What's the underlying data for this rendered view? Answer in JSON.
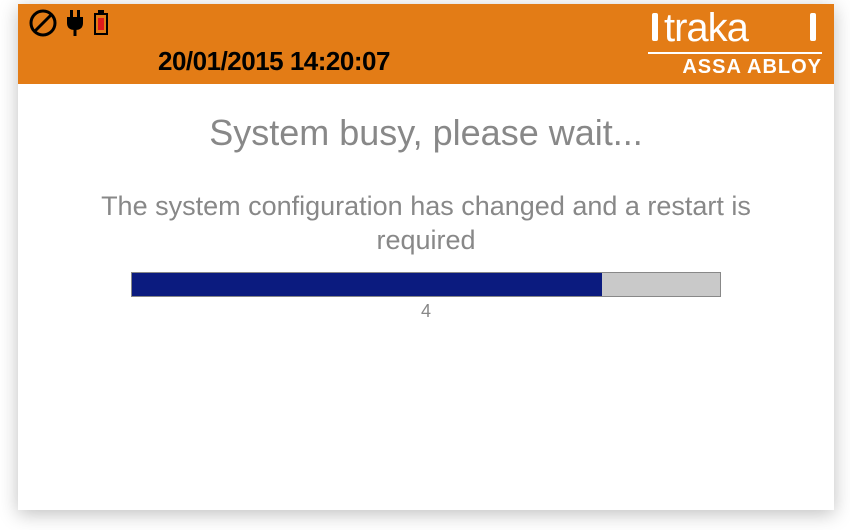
{
  "header": {
    "datetime": "20/01/2015 14:20:07",
    "brand_name": "traka",
    "brand_parent": "ASSA ABLOY"
  },
  "icons": {
    "prohibit": "prohibit-icon",
    "plug": "plug-icon",
    "usb": "usb-icon"
  },
  "content": {
    "title": "System busy, please wait...",
    "message": "The system configuration has changed and a restart is required"
  },
  "progress": {
    "percent": 80,
    "count_label": "4"
  },
  "colors": {
    "header_bg": "#e37c16",
    "progress_fill": "#0b1b7f",
    "progress_track": "#c9c9c9",
    "text_muted": "#888888"
  }
}
